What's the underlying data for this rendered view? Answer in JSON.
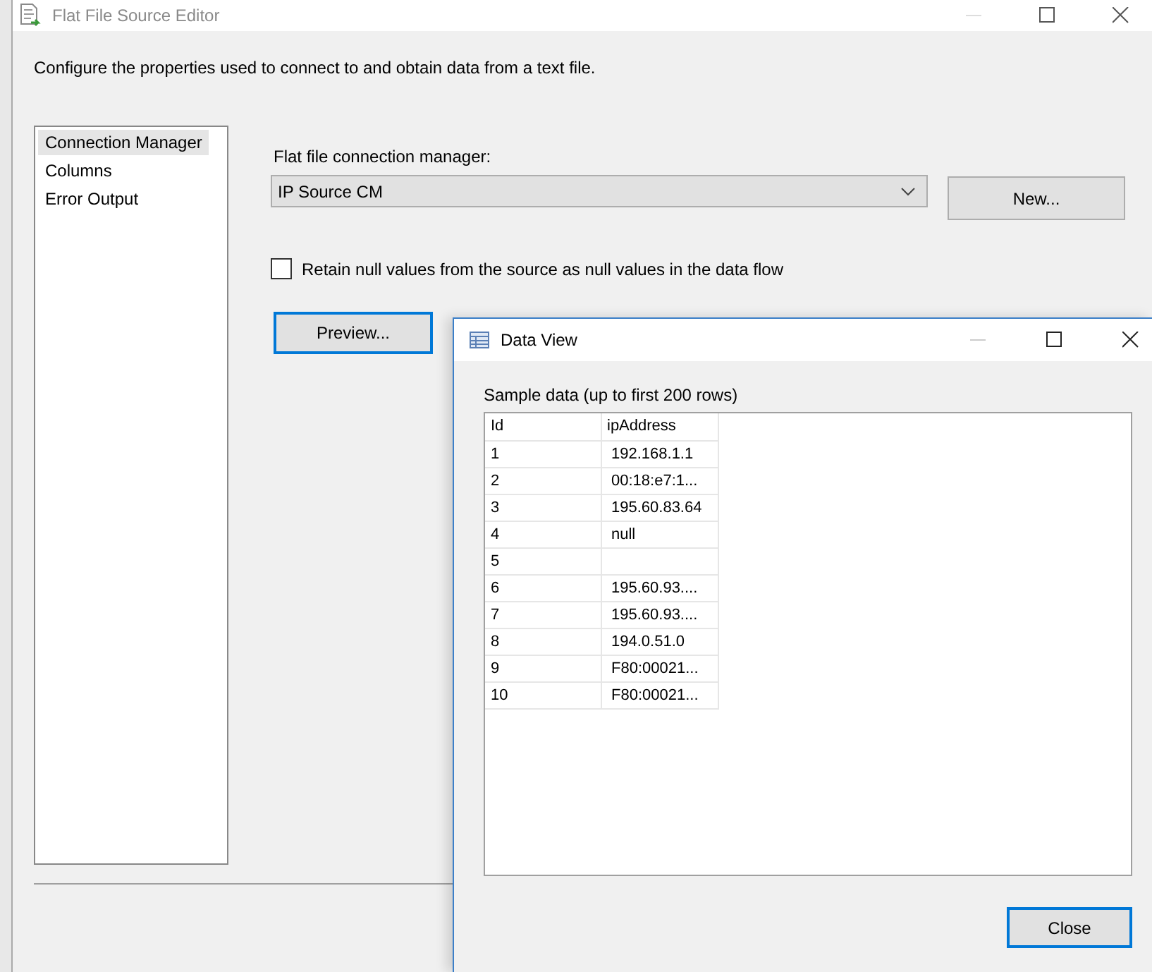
{
  "window": {
    "title": "Flat File Source Editor",
    "description": "Configure the properties used to connect to and obtain data from a text file."
  },
  "sidebar": {
    "items": [
      {
        "label": "Connection Manager",
        "selected": true
      },
      {
        "label": "Columns",
        "selected": false
      },
      {
        "label": "Error Output",
        "selected": false
      }
    ]
  },
  "connection": {
    "label": "Flat file connection manager:",
    "value": "IP Source CM",
    "new_button": "New..."
  },
  "retain_nulls": {
    "label": "Retain null values from the source as null values in the data flow",
    "checked": false
  },
  "preview_button": "Preview...",
  "data_view": {
    "title": "Data View",
    "caption": "Sample data (up to first 200 rows)",
    "columns": [
      "Id",
      "ipAddress"
    ],
    "rows": [
      [
        "1",
        "192.168.1.1"
      ],
      [
        "2",
        "00:18:e7:1..."
      ],
      [
        "3",
        "195.60.83.64"
      ],
      [
        "4",
        "null"
      ],
      [
        "5",
        ""
      ],
      [
        "6",
        "195.60.93...."
      ],
      [
        "7",
        "195.60.93...."
      ],
      [
        "8",
        "194.0.51.0"
      ],
      [
        "9",
        "F80:00021..."
      ],
      [
        "10",
        "F80:00021..."
      ]
    ],
    "close_button": "Close"
  }
}
